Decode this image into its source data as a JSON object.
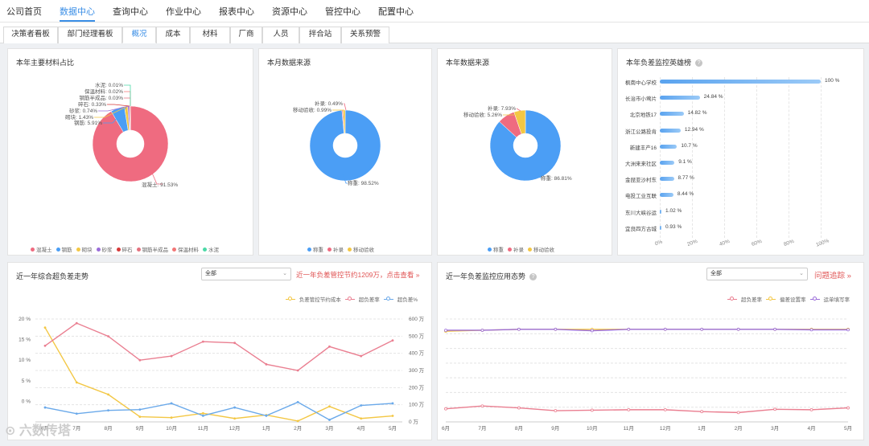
{
  "nav": {
    "items": [
      "公司首页",
      "数据中心",
      "查询中心",
      "作业中心",
      "报表中心",
      "资源中心",
      "管控中心",
      "配置中心"
    ],
    "active": "数据中心"
  },
  "tabs": {
    "items": [
      "决策者看板",
      "部门经理看板",
      "概况",
      "成本",
      "材料",
      "厂商",
      "人员",
      "拌合站",
      "关系预警"
    ],
    "active": "概况"
  },
  "material_panel": {
    "title": "本年主要材料占比",
    "chart_data": {
      "type": "pie",
      "categories": [
        "混凝土",
        "钢筋",
        "砌块",
        "砂浆",
        "碎石",
        "钢筋半成品",
        "保温材料",
        "水泥"
      ],
      "values": [
        91.53,
        5.91,
        1.43,
        0.74,
        0.33,
        0.03,
        0.02,
        0.01
      ],
      "labels": [
        "混凝土: 91.53%",
        "钢筋: 5.91%",
        "砌块: 1.43%",
        "砂浆: 0.74%",
        "碎石: 0.33%",
        "钢筋半成品: 0.03%",
        "保温材料: 0.02%",
        "水泥: 0.01%"
      ],
      "colors": [
        "#ef6b80",
        "#4b9ef5",
        "#f3c744",
        "#9b6dd9",
        "#d63a3a",
        "#e4727e",
        "#f27676",
        "#4cd9a7"
      ],
      "legend_position": "bottom"
    }
  },
  "month_source_panel": {
    "title": "本月数据来源",
    "chart_data": {
      "type": "pie",
      "categories": [
        "称重",
        "补录",
        "移动验收"
      ],
      "values": [
        98.52,
        0.49,
        0.99
      ],
      "labels": [
        "称重: 98.52%",
        "补录: 0.49%",
        "移动验收: 0.99%"
      ],
      "colors": [
        "#4b9ef5",
        "#ef6b80",
        "#f3c744"
      ],
      "legend_position": "bottom"
    }
  },
  "year_source_panel": {
    "title": "本年数据来源",
    "chart_data": {
      "type": "pie",
      "categories": [
        "称重",
        "补录",
        "移动验收"
      ],
      "values": [
        86.81,
        7.93,
        5.26
      ],
      "labels": [
        "称重: 86.81%",
        "补录: 7.93%",
        "移动验收: 5.26%"
      ],
      "colors": [
        "#4b9ef5",
        "#ef6b80",
        "#f3c744"
      ],
      "legend_position": "bottom"
    }
  },
  "rank_panel": {
    "title": "本年负差监控英雄榜",
    "info_icon": "info-icon",
    "chart_data": {
      "type": "bar",
      "orientation": "horizontal",
      "categories": [
        "枫南中心学校",
        "长治市小莺片",
        "北京地铁17",
        "浙江公路投肯",
        "新建丰产16",
        "大洲来来社区",
        "金琵亚沙村东",
        "电投工业互联",
        "东川大峡谷运",
        "宜良四方古城"
      ],
      "values": [
        100,
        24.84,
        14.82,
        12.94,
        10.7,
        9.1,
        8.77,
        8.44,
        1.02,
        0.93
      ],
      "value_labels": [
        "100 %",
        "24.84 %",
        "14.82 %",
        "12.94 %",
        "10.7 %",
        "9.1 %",
        "8.77 %",
        "8.44 %",
        "1.02 %",
        "0.93 %"
      ],
      "x_ticks": [
        "0%",
        "20%",
        "40%",
        "60%",
        "80%",
        "100%"
      ],
      "xlim": [
        0,
        100
      ],
      "grid": true
    }
  },
  "trend_panel": {
    "title": "近一年综合超负差走势",
    "select_value": "全部",
    "link_text": "近一年负差管控节约1209万，点击查看 »",
    "chart_data": {
      "type": "line",
      "categories": [
        "6月",
        "7月",
        "8月",
        "9月",
        "10月",
        "11月",
        "12月",
        "1月",
        "2月",
        "3月",
        "4月",
        "5月"
      ],
      "series": [
        {
          "name": "负差管控节约成本",
          "axis": "right",
          "values": [
            550,
            230,
            160,
            30,
            25,
            50,
            20,
            40,
            5,
            90,
            20,
            35
          ],
          "color": "#f3c744"
        },
        {
          "name": "超负差率",
          "axis": "left",
          "values": [
            13.5,
            19,
            15.8,
            10,
            11,
            14.5,
            14.2,
            9,
            7.5,
            13.3,
            11,
            14.8
          ],
          "color": "#ea7f91"
        },
        {
          "name": "超负差%",
          "axis": "left",
          "values": [
            -1.5,
            -3,
            -2.2,
            -2,
            -0.5,
            -3.5,
            -1.5,
            -3.5,
            -0.2,
            -4.5,
            -1,
            -0.5
          ],
          "color": "#6aa9ea"
        }
      ],
      "y_left_ticks": [
        "20 %",
        "15 %",
        "10 %",
        "5 %",
        "0 %"
      ],
      "ylim_left": [
        -5,
        20
      ],
      "y_right_ticks": [
        "600 万",
        "500 万",
        "400 万",
        "300 万",
        "200 万",
        "100 万",
        "0 万"
      ],
      "ylim_right": [
        0,
        600
      ],
      "legend_position": "top-right",
      "grid": true
    }
  },
  "monitor_panel": {
    "title": "近一年负差监控应用态势",
    "info_icon": "info-icon",
    "select_value": "全部",
    "link_text": "问题追踪 »",
    "chart_data": {
      "type": "line",
      "categories": [
        "6月",
        "7月",
        "8月",
        "9月",
        "10月",
        "11月",
        "12月",
        "1月",
        "2月",
        "3月",
        "4月",
        "5月"
      ],
      "series": [
        {
          "name": "超负差率",
          "values": [
            14,
            17,
            15,
            12,
            12.5,
            13,
            13,
            11,
            10,
            13.5,
            13,
            15
          ],
          "color": "#ea7f91"
        },
        {
          "name": "偏差设置率",
          "values": [
            97,
            98,
            99,
            99,
            99,
            99,
            99,
            99,
            99,
            99,
            99,
            99
          ],
          "color": "#f3c744"
        },
        {
          "name": "运单填写率",
          "values": [
            98,
            98,
            99,
            99,
            97.5,
            99,
            99,
            99,
            99,
            99,
            98.5,
            98.5
          ],
          "color": "#9b6dd9"
        }
      ],
      "ylim": [
        0,
        110
      ],
      "legend_position": "top-right",
      "grid": true
    }
  },
  "watermark": "六数传塔"
}
